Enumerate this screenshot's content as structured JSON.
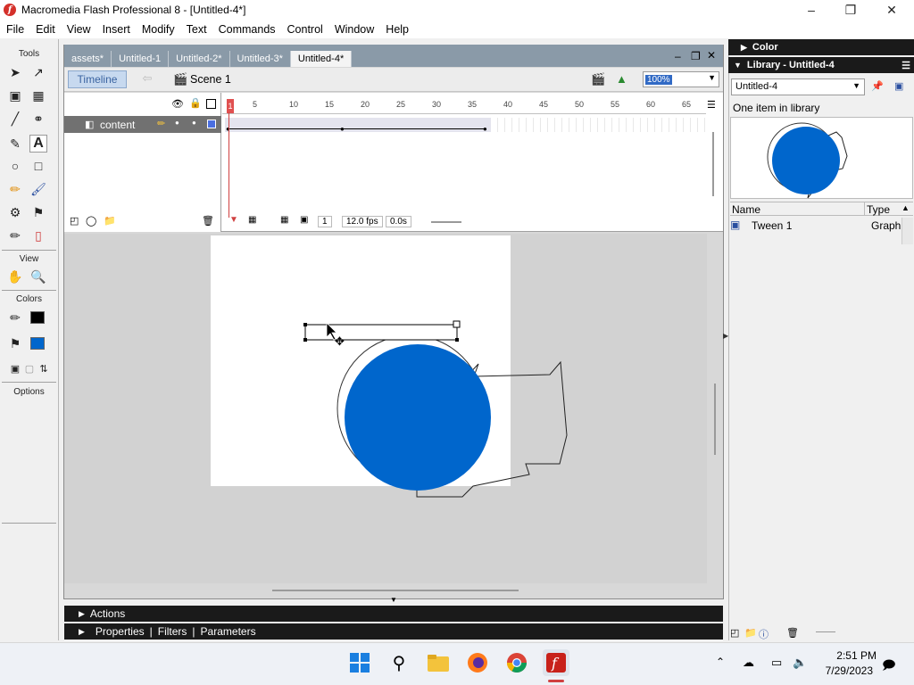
{
  "window": {
    "title": "Macromedia Flash Professional 8 - [Untitled-4*]",
    "app_icon_glyph": "f"
  },
  "menu": [
    "File",
    "Edit",
    "View",
    "Insert",
    "Modify",
    "Text",
    "Commands",
    "Control",
    "Window",
    "Help"
  ],
  "tools": {
    "header": "Tools",
    "view_header": "View",
    "colors_header": "Colors",
    "options_header": "Options",
    "stroke_color": "#000000",
    "fill_color": "#0066cc"
  },
  "doc_tabs": [
    "assets*",
    "Untitled-1",
    "Untitled-2*",
    "Untitled-3*",
    "Untitled-4*"
  ],
  "active_tab_index": 4,
  "toolbar": {
    "timeline_label": "Timeline",
    "scene_label": "Scene 1",
    "zoom": "100%"
  },
  "timeline": {
    "frame_numbers": [
      "1",
      "5",
      "10",
      "15",
      "20",
      "25",
      "30",
      "35",
      "40",
      "45",
      "50",
      "55",
      "60",
      "65"
    ],
    "layer_name": "content",
    "current_frame": "1",
    "fps": "12.0 fps",
    "elapsed": "0.0s"
  },
  "panels": {
    "color_label": "Color",
    "library_label": "Library - Untitled-4",
    "library_doc": "Untitled-4",
    "library_count": "One item in library",
    "columns": {
      "name": "Name",
      "type": "Type"
    },
    "items": [
      {
        "name": "Tween 1",
        "type": "Graph"
      }
    ]
  },
  "bottom_panels": {
    "actions": "Actions",
    "properties": "Properties",
    "filters": "Filters",
    "parameters": "Parameters"
  },
  "taskbar": {
    "time": "2:51 PM",
    "date": "7/29/2023"
  },
  "colors": {
    "circle_fill": "#0066cc",
    "accent": "#3a63a0"
  }
}
